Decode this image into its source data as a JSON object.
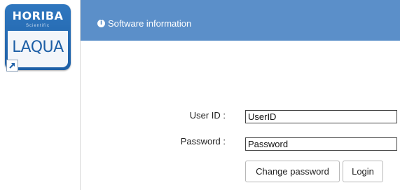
{
  "desktop_icon": {
    "brand_text": "HORIBA",
    "brand_subtext": "Scientific",
    "product_text": "LAQUA",
    "colors": {
      "tile": "#2f77bf",
      "product_panel": "#f3f6fa",
      "product_text": "#1d5fa6"
    },
    "overlay_icon": "shortcut-arrow-icon"
  },
  "header": {
    "icon": "info-circle-icon",
    "title": "Software information",
    "background": "#5b8fc9"
  },
  "login_form": {
    "user_id": {
      "label": "User ID :",
      "value": "UserID"
    },
    "password": {
      "label": "Password :",
      "value": "Password"
    },
    "buttons": {
      "change_password": "Change password",
      "login": "Login"
    }
  }
}
